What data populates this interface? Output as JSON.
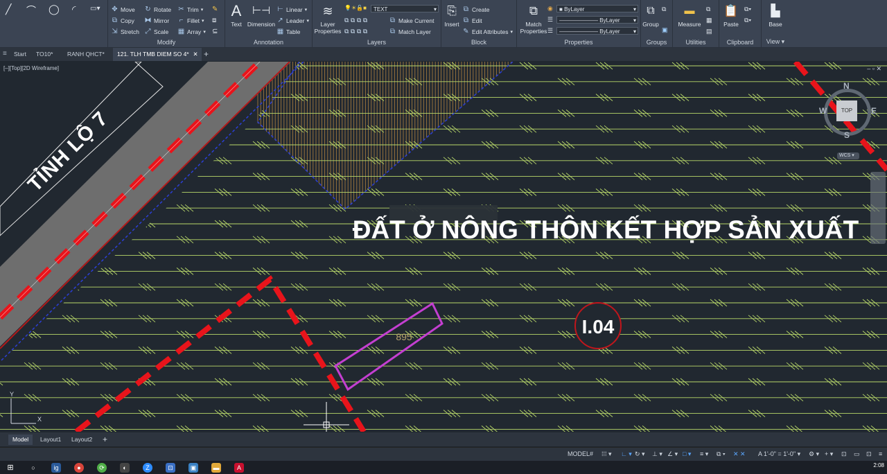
{
  "ribbon": {
    "modify": {
      "title": "Modify",
      "items": [
        "Move",
        "Rotate",
        "Trim",
        "Copy",
        "Mirror",
        "Fillet",
        "Stretch",
        "Scale",
        "Array"
      ]
    },
    "annotation": {
      "title": "Annotation",
      "text": "Text",
      "dimension": "Dimension",
      "linear": "Linear",
      "leader": "Leader",
      "table": "Table"
    },
    "layers": {
      "title": "Layers",
      "layer_properties": "Layer Properties",
      "current_layer": "TEXT",
      "make_current": "Make Current",
      "match_layer": "Match Layer"
    },
    "block": {
      "title": "Block",
      "insert": "Insert",
      "create": "Create",
      "edit": "Edit",
      "edit_attributes": "Edit Attributes"
    },
    "properties": {
      "title": "Properties",
      "match_properties": "Match Properties",
      "color": "ByLayer",
      "linetype": "ByLayer",
      "lineweight": "ByLayer"
    },
    "groups": {
      "title": "Groups",
      "group": "Group"
    },
    "utilities": {
      "title": "Utilities",
      "measure": "Measure"
    },
    "clipboard": {
      "title": "Clipboard",
      "paste": "Paste"
    },
    "view": {
      "title": "View",
      "base": "Base"
    }
  },
  "file_tabs": [
    "Start",
    "TO10*",
    "RANH QHCT*",
    "121. TLH TMB DIEM SO 4*"
  ],
  "active_tab_index": 3,
  "viewport_label": "[–][Top][2D Wireframe]",
  "drawing": {
    "road_label": "TỈNH LỘ 7",
    "land_use_label": "ĐẤT Ở NÔNG THÔN KẾT HỢP SẢN XUẤT",
    "zone_code": "I.04",
    "lot_number": "895"
  },
  "viewcube": {
    "north": "N",
    "south": "S",
    "east": "E",
    "west": "W",
    "top": "TOP",
    "wcs": "WCS"
  },
  "layout_tabs": [
    "Model",
    "Layout1",
    "Layout2"
  ],
  "status_bar": {
    "mode": "MODEL",
    "scale": "1'-0\" = 1'-0\""
  },
  "clock": "2:08",
  "colors": {
    "hatch": "#b9d96a",
    "boundary": "#e8141b",
    "lot": "#c43fd1",
    "road": "#757575",
    "background": "#212830"
  }
}
